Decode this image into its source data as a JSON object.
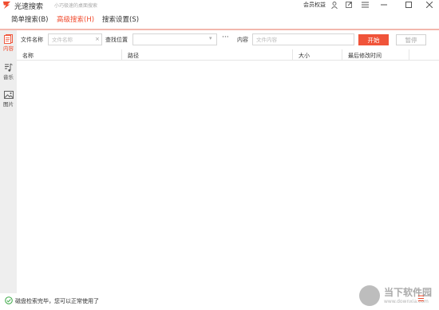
{
  "titlebar": {
    "app_name": "光速搜索",
    "slogan": "小巧极速的桌面搜索",
    "member_label": "会员权益",
    "icons": [
      "user-icon",
      "pin-icon",
      "menu-icon",
      "minimize-icon",
      "maximize-icon",
      "close-icon"
    ]
  },
  "menu": {
    "items": [
      {
        "label": "简单搜索(B)",
        "active": false
      },
      {
        "label": "高级搜索(H)",
        "active": true
      },
      {
        "label": "搜索设置(S)",
        "active": false
      }
    ]
  },
  "sidebar": {
    "items": [
      {
        "label": "内容",
        "icon": "document-icon",
        "active": true
      },
      {
        "label": "音乐",
        "icon": "music-icon",
        "active": false
      },
      {
        "label": "图片",
        "icon": "image-icon",
        "active": false
      }
    ]
  },
  "search": {
    "filename_label": "文件名称",
    "filename_placeholder": "文件名称",
    "filename_value": "",
    "location_label": "查找位置",
    "location_value": "",
    "more_label": "···",
    "content_label": "内容",
    "content_placeholder": "文件内容",
    "content_value": "",
    "start_label": "开始",
    "pause_label": "暂停"
  },
  "table": {
    "columns": [
      "名称",
      "路径",
      "大小",
      "最后修改时间"
    ],
    "rows": []
  },
  "status": {
    "text": "磁盘检索完毕，您可以正常使用了",
    "menu_icon": "list-icon"
  },
  "watermark": {
    "text": "当下软件园",
    "url": "www.downxia.com"
  },
  "colors": {
    "accent": "#f04b2e",
    "sidebar_bg": "#eeeeee",
    "start_button": "#f0543a"
  }
}
